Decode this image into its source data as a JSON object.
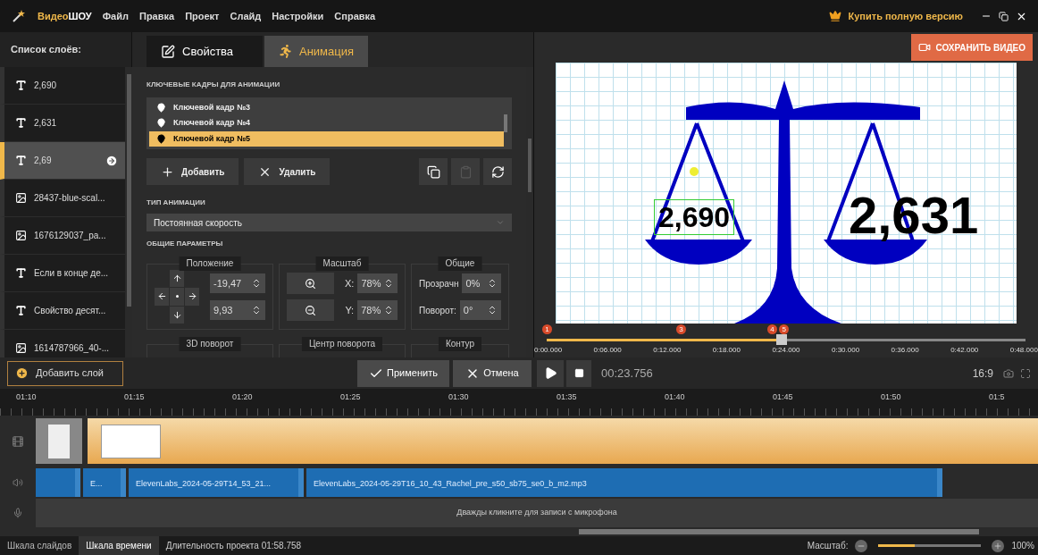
{
  "app": {
    "brand": [
      "Видео",
      "ШОУ"
    ],
    "menu": [
      "Файл",
      "Правка",
      "Проект",
      "Слайд",
      "Настройки",
      "Справка"
    ],
    "buy_link": "Купить полную версию"
  },
  "layers": {
    "title": "Список слоёв:",
    "items": [
      {
        "kind": "text",
        "label": "2,690",
        "selected": false
      },
      {
        "kind": "text",
        "label": "2,631",
        "selected": false
      },
      {
        "kind": "text",
        "label": "2,69",
        "selected": true
      },
      {
        "kind": "image",
        "label": "28437-blue-scal...",
        "selected": false
      },
      {
        "kind": "image",
        "label": "1676129037_pa...",
        "selected": false
      },
      {
        "kind": "text",
        "label": "Если в конце де...",
        "selected": false
      },
      {
        "kind": "text",
        "label": "Свойство десят...",
        "selected": false
      },
      {
        "kind": "image",
        "label": "1614787966_40-...",
        "selected": false
      }
    ]
  },
  "tabs": [
    {
      "kind": "properties",
      "label": "Свойства",
      "selected": false
    },
    {
      "kind": "animation",
      "label": "Анимация",
      "selected": true
    }
  ],
  "keyframes": {
    "title": "КЛЮЧЕВЫЕ КАДРЫ ДЛЯ АНИМАЦИИ",
    "items": [
      {
        "label": "Ключевой кадр №3",
        "selected": false
      },
      {
        "label": "Ключевой кадр №4",
        "selected": false
      },
      {
        "label": "Ключевой кадр №5",
        "selected": true
      }
    ]
  },
  "keyframe_buttons": [
    {
      "kind": "add",
      "label": "Добавить"
    },
    {
      "kind": "delete",
      "label": "Удалить"
    }
  ],
  "tool_buttons": [
    {
      "kind": "copy",
      "disabled": false
    },
    {
      "kind": "paste",
      "disabled": true
    },
    {
      "kind": "refresh",
      "disabled": false
    }
  ],
  "animation_type": {
    "title": "ТИП АНИМАЦИИ",
    "value": "Постоянная скорость"
  },
  "general": {
    "title": "ОБЩИЕ ПАРАМЕТРЫ",
    "groups": [
      {
        "kind": "position",
        "title": "Положение",
        "fields": [
          {
            "value": "-19,47"
          },
          {
            "value": "9,93"
          }
        ]
      },
      {
        "kind": "scale",
        "title": "Масштаб",
        "fields": [
          {
            "label": "X:",
            "value": "78%"
          },
          {
            "label": "Y:",
            "value": "78%"
          }
        ]
      },
      {
        "kind": "common",
        "title": "Общие",
        "fields": [
          {
            "label": "Прозрачн",
            "value": "0%"
          },
          {
            "label": "Поворот:",
            "value": "0°"
          }
        ]
      }
    ],
    "more_groups": [
      "3D поворот",
      "Центр поворота",
      "Контур"
    ]
  },
  "actions": {
    "add_layer": "Добавить слой",
    "apply": "Применить",
    "cancel": "Отмена"
  },
  "preview": {
    "save_button": "СОХРАНИТЬ ВИДЕО",
    "slide_texts": [
      {
        "text": "2,690",
        "selected": true
      },
      {
        "text": "2,631",
        "selected": false
      }
    ],
    "slider": {
      "level": 0.49,
      "markers": [
        {
          "label": "1",
          "level": 0
        },
        {
          "label": "3",
          "level": 0.28
        },
        {
          "label": "4",
          "level": 0.47
        },
        {
          "label": "5",
          "level": 0.495
        }
      ],
      "ticks": [
        "0:00.000",
        "0:06.000",
        "0:12.000",
        "0:18.000",
        "0:24.000",
        "0:30.000",
        "0:36.000",
        "0:42.000",
        "0:48.000"
      ]
    },
    "time": "00:23.756",
    "aspect": "16:9"
  },
  "timeline": {
    "ruler": [
      "01:10",
      "01:15",
      "01:20",
      "01:25",
      "01:30",
      "01:35",
      "01:40",
      "01:45",
      "01:50",
      "01:5"
    ],
    "audio_clips": [
      {
        "kind": "unlabeled"
      },
      {
        "kind": "labeled",
        "label": "E..."
      },
      {
        "kind": "labeled",
        "label": "ElevenLabs_2024-05-29T14_53_21..."
      },
      {
        "kind": "labeled",
        "label": "ElevenLabs_2024-05-29T16_10_43_Rachel_pre_s50_sb75_se0_b_m2.mp3"
      }
    ],
    "mic_hint": "Дважды кликните для записи с микрофона"
  },
  "status": {
    "tabs": [
      {
        "label": "Шкала слайдов",
        "selected": false
      },
      {
        "label": "Шкала времени",
        "selected": true
      }
    ],
    "duration": "Длительность проекта 01:58.758",
    "zoom_label": "Масштаб:",
    "zoom": {
      "level": 0.35
    },
    "zoom_value": "100%"
  }
}
